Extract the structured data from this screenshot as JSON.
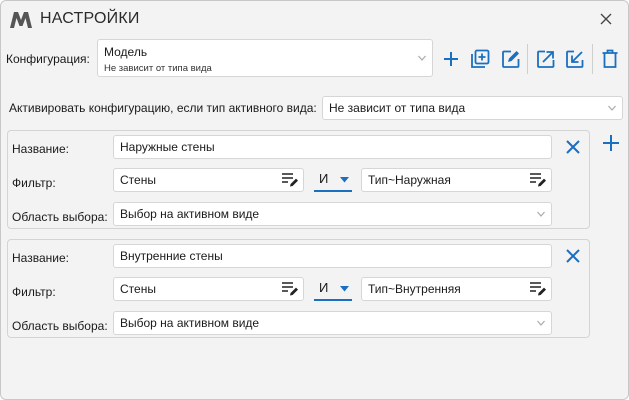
{
  "window": {
    "title": "НАСТРОЙКИ"
  },
  "config": {
    "label": "Конфигурация:",
    "selected_main": "Модель",
    "selected_sub": "Не зависит от типа вида"
  },
  "activate": {
    "label": "Активировать конфигурацию, если тип активного вида:",
    "selected": "Не зависит от типа вида"
  },
  "labels": {
    "name": "Название:",
    "filter": "Фильтр:",
    "scope": "Область выбора:"
  },
  "rules": [
    {
      "name": "Наружные стены",
      "filter_left": "Стены",
      "operator": "И",
      "filter_right": "Тип~Наружная",
      "scope": "Выбор на активном виде"
    },
    {
      "name": "Внутренние стены",
      "filter_left": "Стены",
      "operator": "И",
      "filter_right": "Тип~Внутренняя",
      "scope": "Выбор на активном виде"
    }
  ],
  "colors": {
    "accent": "#1a6fc0",
    "window_bg": "#f3f3f3"
  }
}
